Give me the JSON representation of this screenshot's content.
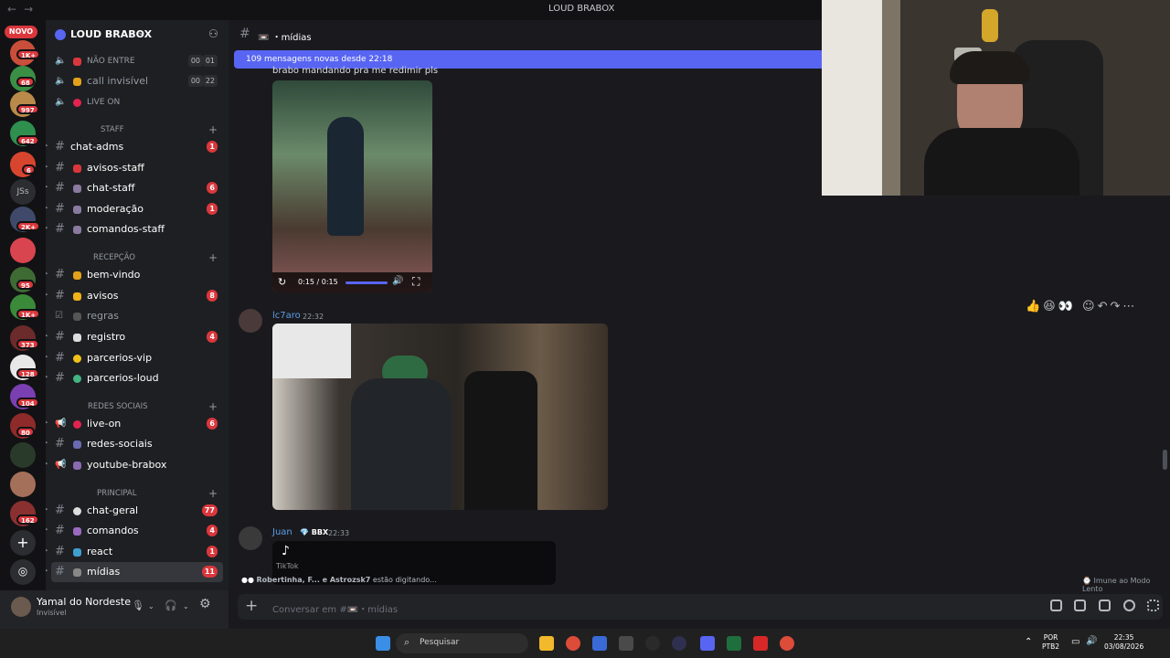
{
  "window": {
    "title": "LOUD BRABOX",
    "back": "←",
    "forward": "→"
  },
  "servers": {
    "novo_label": "NOVO",
    "badges": [
      "1K+",
      "68",
      "997",
      "642",
      "6",
      "2K+",
      "95",
      "1K+",
      "373",
      "128",
      "104",
      "80",
      "162"
    ],
    "text_server": "JSs"
  },
  "guild": {
    "name": "LOUD BRABOX",
    "chevron": "⌄"
  },
  "voice_channels": [
    {
      "name": "NÃO ENTRE",
      "pill_a": "00",
      "pill_b": "01"
    },
    {
      "name": "call invisível",
      "pill_a": "00",
      "pill_b": "22"
    },
    {
      "name": "LIVE ON"
    }
  ],
  "categories": {
    "staff": "STAFF",
    "recepcao": "RECEPÇÃO",
    "redes": "REDES SOCIAIS",
    "principal": "PRINCIPAL"
  },
  "channels": [
    {
      "name": "chat-adms",
      "badge": "1"
    },
    {
      "name": "avisos-staff",
      "badge": ""
    },
    {
      "name": "chat-staff",
      "badge": "6"
    },
    {
      "name": "moderação",
      "badge": "1"
    },
    {
      "name": "comandos-staff",
      "badge": ""
    },
    {
      "name": "bem-vindo",
      "badge": ""
    },
    {
      "name": "avisos",
      "badge": "8"
    },
    {
      "name": "regras",
      "badge": ""
    },
    {
      "name": "registro",
      "badge": "4"
    },
    {
      "name": "parcerios-vip",
      "badge": ""
    },
    {
      "name": "parcerios-loud",
      "badge": ""
    },
    {
      "name": "live-on",
      "badge": "6"
    },
    {
      "name": "redes-sociais",
      "badge": ""
    },
    {
      "name": "youtube-brabox",
      "badge": ""
    },
    {
      "name": "chat-geral",
      "badge": "77"
    },
    {
      "name": "comandos",
      "badge": "4"
    },
    {
      "name": "react",
      "badge": "1"
    },
    {
      "name": "mídias",
      "badge": "11"
    }
  ],
  "user": {
    "name": "Yamal do Nordeste",
    "status": "Invisível"
  },
  "channel_header": {
    "name": "mídias"
  },
  "new_messages_bar": "109 mensagens novas desde 22:18",
  "messages": [
    {
      "text": "brabo mandando pra me redimir pls",
      "video_time": "0:15 / 0:15"
    },
    {
      "author": "lc7aro",
      "time": "22:32"
    },
    {
      "author": "Juan",
      "tag": "BBX",
      "time": "22:33",
      "embed": "TikTok"
    }
  ],
  "typing": {
    "names": "Robertinha, F... e Astrozsk7",
    "suffix": " estão digitando..."
  },
  "slow_mode": "Imune ao Modo Lento",
  "composer": {
    "placeholder": "Conversar em #📼・mídias"
  },
  "taskbar": {
    "search": "Pesquisar",
    "lang_a": "POR",
    "lang_b": "PTB2",
    "time": "22:35",
    "date": "03/08/2026"
  },
  "colors": {
    "accent": "#5865f2",
    "badge": "#da373c",
    "link": "#5a9ee8"
  }
}
